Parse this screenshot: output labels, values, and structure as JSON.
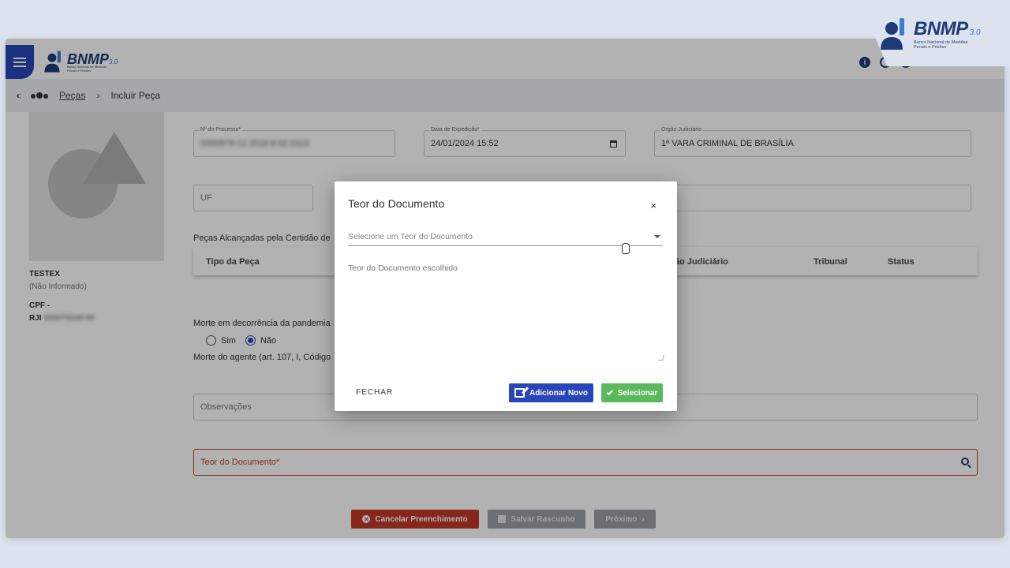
{
  "brand": {
    "name": "BNMP",
    "version": "3.0",
    "subtitle": "Banco Nacional de Medidas Penais e Prisões"
  },
  "header": {
    "icons": [
      "info-icon",
      "help-icon",
      "user-search-icon"
    ]
  },
  "breadcrumb": {
    "parent": "Peças",
    "separator": "›",
    "current": "Incluir Peça"
  },
  "person": {
    "name": "TESTEX",
    "note": "(Não Informado)",
    "cpf_label": "CPF -",
    "rji_label": "RJI",
    "rji_value": "000075048-86"
  },
  "form": {
    "processo": {
      "label": "Nº do Processo*",
      "value": "0000979-12.2018.8.02.0113"
    },
    "data_expedicao": {
      "label": "Data de Expedição*",
      "value": "24/01/2024 15:52"
    },
    "orgao_judiciario": {
      "label": "Órgão Judiciário",
      "value": "1ª VARA CRIMINAL DE BRASÍLIA"
    },
    "uf": {
      "placeholder": "UF"
    },
    "pecas_title": "Peças Alcançadas pela Certidão de",
    "table_headers": [
      "Tipo da Peça",
      "ão Judiciário",
      "Tribunal",
      "Status"
    ],
    "morte_pandemia_label": "Morte em decorrência da pandemia",
    "radio_options": [
      {
        "label": "Sim",
        "selected": false
      },
      {
        "label": "Não",
        "selected": true
      }
    ],
    "morte_agente_label": "Morte do agente (art. 107, I, Código",
    "observacoes_placeholder": "Observações",
    "teor_placeholder": "Teor do Documento*"
  },
  "footer_buttons": {
    "cancel": "Cancelar Preenchimento",
    "save": "Salvar Rascunho",
    "next": "Próximo"
  },
  "modal": {
    "title": "Teor do Documento",
    "close": "×",
    "select_placeholder": "Selecione um Teor do Documento",
    "textarea_placeholder": "Teor do Documento escolhido",
    "fechar": "FECHAR",
    "add_new": "Adicionar Novo",
    "select": "Selecionar"
  },
  "colors": {
    "primary": "#2946b8",
    "success": "#5cb85c",
    "danger": "#c0392b"
  }
}
